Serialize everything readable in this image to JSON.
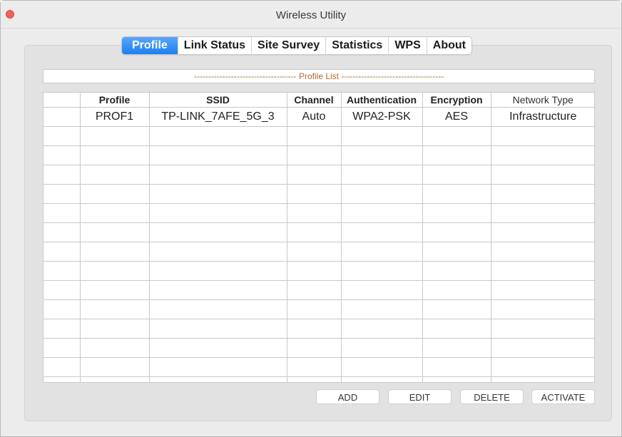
{
  "window": {
    "title": "Wireless Utility"
  },
  "tabs": [
    {
      "label": "Profile",
      "active": true
    },
    {
      "label": "Link Status"
    },
    {
      "label": "Site Survey"
    },
    {
      "label": "Statistics"
    },
    {
      "label": "WPS"
    },
    {
      "label": "About"
    }
  ],
  "profile_list": {
    "header": "------------------------------------ Profile List ------------------------------------",
    "columns": [
      "",
      "Profile",
      "SSID",
      "Channel",
      "Authentication",
      "Encryption",
      "Network Type"
    ],
    "rows": [
      {
        "marker": "",
        "profile": "PROF1",
        "ssid": "TP-LINK_7AFE_5G_3",
        "channel": "Auto",
        "authentication": "WPA2-PSK",
        "encryption": "AES",
        "network_type": "Infrastructure"
      }
    ]
  },
  "buttons": {
    "add": "ADD",
    "edit": "EDIT",
    "delete": "DELETE",
    "activate": "ACTIVATE"
  },
  "colors": {
    "active_tab": "#1b80f4",
    "close_button": "#f0605d",
    "list_header_text": "#b36b2a"
  }
}
